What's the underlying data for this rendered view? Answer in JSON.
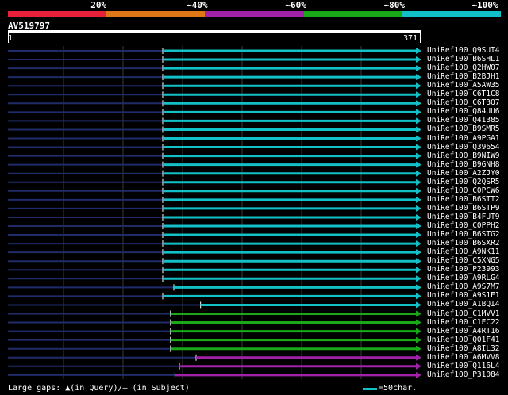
{
  "colors": {
    "background": "#000000",
    "grid": "#3a3a3a",
    "query_line": "#202c6a",
    "red": "#e8203a",
    "orange": "#e07818",
    "purple": "#a022a8",
    "green": "#18a818",
    "cyan": "#12c0c8",
    "text": "#ffffff"
  },
  "legend": {
    "labels": [
      "20%",
      "~40%",
      "~60%",
      "~80%",
      "~100%"
    ],
    "colors": [
      "#e8203a",
      "#e07818",
      "#a022a8",
      "#18a818",
      "#12c0c8"
    ]
  },
  "query": {
    "title": "AV519797",
    "start_label": "1",
    "end_label": "371",
    "length": 371
  },
  "hits": [
    {
      "id": "UniRef100_Q9SUI4",
      "start": 140,
      "end": 371,
      "color": "cyan"
    },
    {
      "id": "UniRef100_B6SHL1",
      "start": 140,
      "end": 371,
      "color": "cyan"
    },
    {
      "id": "UniRef100_Q2HW07",
      "start": 140,
      "end": 371,
      "color": "cyan"
    },
    {
      "id": "UniRef100_B2BJH1",
      "start": 140,
      "end": 371,
      "color": "cyan"
    },
    {
      "id": "UniRef100_A5AW35",
      "start": 140,
      "end": 371,
      "color": "cyan"
    },
    {
      "id": "UniRef100_C6T1C8",
      "start": 140,
      "end": 371,
      "color": "cyan"
    },
    {
      "id": "UniRef100_C6T3Q7",
      "start": 140,
      "end": 371,
      "color": "cyan"
    },
    {
      "id": "UniRef100_Q84UU6",
      "start": 140,
      "end": 371,
      "color": "cyan"
    },
    {
      "id": "UniRef100_Q41385",
      "start": 140,
      "end": 371,
      "color": "cyan"
    },
    {
      "id": "UniRef100_B9SMR5",
      "start": 140,
      "end": 371,
      "color": "cyan"
    },
    {
      "id": "UniRef100_A9PGA1",
      "start": 140,
      "end": 371,
      "color": "cyan"
    },
    {
      "id": "UniRef100_Q39654",
      "start": 140,
      "end": 371,
      "color": "cyan"
    },
    {
      "id": "UniRef100_B9NIW9",
      "start": 140,
      "end": 371,
      "color": "cyan"
    },
    {
      "id": "UniRef100_B9GNH8",
      "start": 140,
      "end": 371,
      "color": "cyan"
    },
    {
      "id": "UniRef100_A2ZJY0",
      "start": 140,
      "end": 371,
      "color": "cyan"
    },
    {
      "id": "UniRef100_Q2QSR5",
      "start": 140,
      "end": 371,
      "color": "cyan"
    },
    {
      "id": "UniRef100_C0PCW6",
      "start": 140,
      "end": 371,
      "color": "cyan"
    },
    {
      "id": "UniRef100_B6STT2",
      "start": 140,
      "end": 371,
      "color": "cyan"
    },
    {
      "id": "UniRef100_B6STP9",
      "start": 140,
      "end": 371,
      "color": "cyan"
    },
    {
      "id": "UniRef100_B4FUT9",
      "start": 140,
      "end": 371,
      "color": "cyan"
    },
    {
      "id": "UniRef100_C0PPH2",
      "start": 140,
      "end": 371,
      "color": "cyan"
    },
    {
      "id": "UniRef100_B6STG2",
      "start": 140,
      "end": 371,
      "color": "cyan"
    },
    {
      "id": "UniRef100_B6SXR2",
      "start": 140,
      "end": 371,
      "color": "cyan"
    },
    {
      "id": "UniRef100_A9NK11",
      "start": 140,
      "end": 371,
      "color": "cyan"
    },
    {
      "id": "UniRef100_C5XNG5",
      "start": 140,
      "end": 371,
      "color": "cyan"
    },
    {
      "id": "UniRef100_P23993",
      "start": 140,
      "end": 371,
      "color": "cyan"
    },
    {
      "id": "UniRef100_A9RLG4",
      "start": 140,
      "end": 371,
      "color": "cyan"
    },
    {
      "id": "UniRef100_A9S7M7",
      "start": 150,
      "end": 371,
      "color": "cyan"
    },
    {
      "id": "UniRef100_A9S1E1",
      "start": 140,
      "end": 371,
      "color": "cyan"
    },
    {
      "id": "UniRef100_A1BQI4",
      "start": 174,
      "end": 371,
      "color": "cyan"
    },
    {
      "id": "UniRef100_C1MVV1",
      "start": 147,
      "end": 371,
      "color": "green"
    },
    {
      "id": "UniRef100_C1EC22",
      "start": 147,
      "end": 371,
      "color": "green"
    },
    {
      "id": "UniRef100_A4RT16",
      "start": 147,
      "end": 371,
      "color": "green"
    },
    {
      "id": "UniRef100_Q01F41",
      "start": 147,
      "end": 371,
      "color": "green"
    },
    {
      "id": "UniRef100_A8IL32",
      "start": 147,
      "end": 371,
      "color": "green"
    },
    {
      "id": "UniRef100_A6MVV8",
      "start": 170,
      "end": 371,
      "color": "purple"
    },
    {
      "id": "UniRef100_Q116L4",
      "start": 155,
      "end": 371,
      "color": "purple"
    },
    {
      "id": "UniRef100_P31084",
      "start": 151,
      "end": 371,
      "color": "purple"
    }
  ],
  "footer": {
    "large_gaps_text": "Large gaps: ▲(in Query)/– (in Subject)",
    "scale_text": "=50char."
  }
}
